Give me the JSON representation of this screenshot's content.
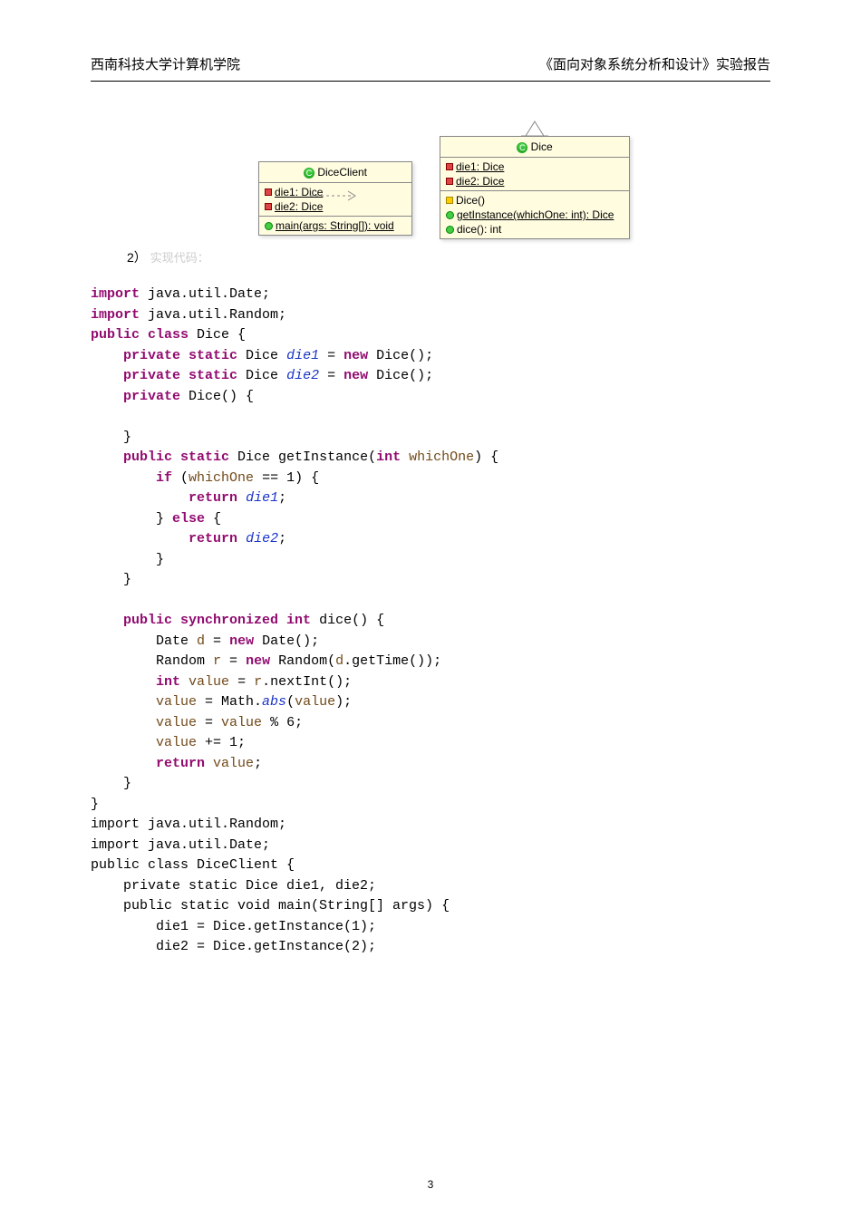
{
  "header": {
    "left": "西南科技大学计算机学院",
    "right": "《面向对象系统分析和设计》实验报告"
  },
  "uml": {
    "client": {
      "title": "DiceClient",
      "fields": [
        "die1: Dice",
        "die2: Dice"
      ],
      "methods": [
        "main(args: String[]): void"
      ]
    },
    "dice": {
      "title": "Dice",
      "fields": [
        "die1: Dice",
        "die2: Dice"
      ],
      "methods": [
        "Dice()",
        "getInstance(whichOne: int): Dice",
        "dice(): int"
      ]
    }
  },
  "section_label": "2）",
  "section_faded": "实现代码：",
  "page": "3",
  "chart_data": {
    "type": "table",
    "title": "UML class diagram",
    "classes": [
      {
        "name": "DiceClient",
        "attributes": [
          "die1: Dice",
          "die2: Dice"
        ],
        "operations": [
          "main(args: String[]): void"
        ]
      },
      {
        "name": "Dice",
        "attributes": [
          "die1: Dice",
          "die2: Dice"
        ],
        "operations": [
          "Dice()",
          "getInstance(whichOne: int): Dice",
          "dice(): int"
        ]
      }
    ],
    "relations": [
      {
        "from": "DiceClient",
        "to": "Dice",
        "type": "dependency"
      }
    ]
  },
  "code": {
    "lines": [
      {
        "t": "kw",
        "s": "import"
      },
      {
        "t": "p",
        "s": " java.util.Date;"
      },
      {
        "t": "nl"
      },
      {
        "t": "kw",
        "s": "import"
      },
      {
        "t": "p",
        "s": " java.util.Random;"
      },
      {
        "t": "nl"
      },
      {
        "t": "kw",
        "s": "public class"
      },
      {
        "t": "p",
        "s": " Dice {"
      },
      {
        "t": "nl"
      },
      {
        "t": "p",
        "s": "    "
      },
      {
        "t": "kw",
        "s": "private static"
      },
      {
        "t": "p",
        "s": " Dice "
      },
      {
        "t": "fld",
        "s": "die1"
      },
      {
        "t": "p",
        "s": " = "
      },
      {
        "t": "kw",
        "s": "new"
      },
      {
        "t": "p",
        "s": " Dice();"
      },
      {
        "t": "nl"
      },
      {
        "t": "p",
        "s": "    "
      },
      {
        "t": "kw",
        "s": "private static"
      },
      {
        "t": "p",
        "s": " Dice "
      },
      {
        "t": "fld",
        "s": "die2"
      },
      {
        "t": "p",
        "s": " = "
      },
      {
        "t": "kw",
        "s": "new"
      },
      {
        "t": "p",
        "s": " Dice();"
      },
      {
        "t": "nl"
      },
      {
        "t": "p",
        "s": "    "
      },
      {
        "t": "kw",
        "s": "private"
      },
      {
        "t": "p",
        "s": " Dice() {"
      },
      {
        "t": "nl"
      },
      {
        "t": "nl"
      },
      {
        "t": "p",
        "s": "    }"
      },
      {
        "t": "nl"
      },
      {
        "t": "p",
        "s": "    "
      },
      {
        "t": "kw",
        "s": "public static"
      },
      {
        "t": "p",
        "s": " Dice getInstance("
      },
      {
        "t": "kw",
        "s": "int"
      },
      {
        "t": "p",
        "s": " "
      },
      {
        "t": "var",
        "s": "whichOne"
      },
      {
        "t": "p",
        "s": ") {"
      },
      {
        "t": "nl"
      },
      {
        "t": "p",
        "s": "        "
      },
      {
        "t": "kw",
        "s": "if"
      },
      {
        "t": "p",
        "s": " ("
      },
      {
        "t": "var",
        "s": "whichOne"
      },
      {
        "t": "p",
        "s": " == 1) {"
      },
      {
        "t": "nl"
      },
      {
        "t": "p",
        "s": "            "
      },
      {
        "t": "kw",
        "s": "return"
      },
      {
        "t": "p",
        "s": " "
      },
      {
        "t": "fld",
        "s": "die1"
      },
      {
        "t": "p",
        "s": ";"
      },
      {
        "t": "nl"
      },
      {
        "t": "p",
        "s": "        } "
      },
      {
        "t": "kw",
        "s": "else"
      },
      {
        "t": "p",
        "s": " {"
      },
      {
        "t": "nl"
      },
      {
        "t": "p",
        "s": "            "
      },
      {
        "t": "kw",
        "s": "return"
      },
      {
        "t": "p",
        "s": " "
      },
      {
        "t": "fld",
        "s": "die2"
      },
      {
        "t": "p",
        "s": ";"
      },
      {
        "t": "nl"
      },
      {
        "t": "p",
        "s": "        }"
      },
      {
        "t": "nl"
      },
      {
        "t": "p",
        "s": "    }"
      },
      {
        "t": "nl"
      },
      {
        "t": "nl"
      },
      {
        "t": "p",
        "s": "    "
      },
      {
        "t": "kw",
        "s": "public synchronized int"
      },
      {
        "t": "p",
        "s": " dice() {"
      },
      {
        "t": "nl"
      },
      {
        "t": "p",
        "s": "        Date "
      },
      {
        "t": "var",
        "s": "d"
      },
      {
        "t": "p",
        "s": " = "
      },
      {
        "t": "kw",
        "s": "new"
      },
      {
        "t": "p",
        "s": " Date();"
      },
      {
        "t": "nl"
      },
      {
        "t": "p",
        "s": "        Random "
      },
      {
        "t": "var",
        "s": "r"
      },
      {
        "t": "p",
        "s": " = "
      },
      {
        "t": "kw",
        "s": "new"
      },
      {
        "t": "p",
        "s": " Random("
      },
      {
        "t": "var",
        "s": "d"
      },
      {
        "t": "p",
        "s": ".getTime());"
      },
      {
        "t": "nl"
      },
      {
        "t": "p",
        "s": "        "
      },
      {
        "t": "kw",
        "s": "int"
      },
      {
        "t": "p",
        "s": " "
      },
      {
        "t": "var",
        "s": "value"
      },
      {
        "t": "p",
        "s": " = "
      },
      {
        "t": "var",
        "s": "r"
      },
      {
        "t": "p",
        "s": ".nextInt();"
      },
      {
        "t": "nl"
      },
      {
        "t": "p",
        "s": "        "
      },
      {
        "t": "var",
        "s": "value"
      },
      {
        "t": "p",
        "s": " = Math."
      },
      {
        "t": "fld",
        "s": "abs"
      },
      {
        "t": "p",
        "s": "("
      },
      {
        "t": "var",
        "s": "value"
      },
      {
        "t": "p",
        "s": ");"
      },
      {
        "t": "nl"
      },
      {
        "t": "p",
        "s": "        "
      },
      {
        "t": "var",
        "s": "value"
      },
      {
        "t": "p",
        "s": " = "
      },
      {
        "t": "var",
        "s": "value"
      },
      {
        "t": "p",
        "s": " % 6;"
      },
      {
        "t": "nl"
      },
      {
        "t": "p",
        "s": "        "
      },
      {
        "t": "var",
        "s": "value"
      },
      {
        "t": "p",
        "s": " += 1;"
      },
      {
        "t": "nl"
      },
      {
        "t": "p",
        "s": "        "
      },
      {
        "t": "kw",
        "s": "return"
      },
      {
        "t": "p",
        "s": " "
      },
      {
        "t": "var",
        "s": "value"
      },
      {
        "t": "p",
        "s": ";"
      },
      {
        "t": "nl"
      },
      {
        "t": "p",
        "s": "    }"
      },
      {
        "t": "nl"
      },
      {
        "t": "p",
        "s": "}"
      },
      {
        "t": "nl"
      },
      {
        "t": "p",
        "s": "import java.util.Random;"
      },
      {
        "t": "nl"
      },
      {
        "t": "p",
        "s": "import java.util.Date;"
      },
      {
        "t": "nl"
      },
      {
        "t": "p",
        "s": "public class DiceClient {"
      },
      {
        "t": "nl"
      },
      {
        "t": "p",
        "s": "    private static Dice die1, die2;"
      },
      {
        "t": "nl"
      },
      {
        "t": "p",
        "s": "    public static void main(String[] args) {"
      },
      {
        "t": "nl"
      },
      {
        "t": "p",
        "s": "        die1 = Dice.getInstance(1);"
      },
      {
        "t": "nl"
      },
      {
        "t": "p",
        "s": "        die2 = Dice.getInstance(2);"
      },
      {
        "t": "nl"
      }
    ]
  }
}
